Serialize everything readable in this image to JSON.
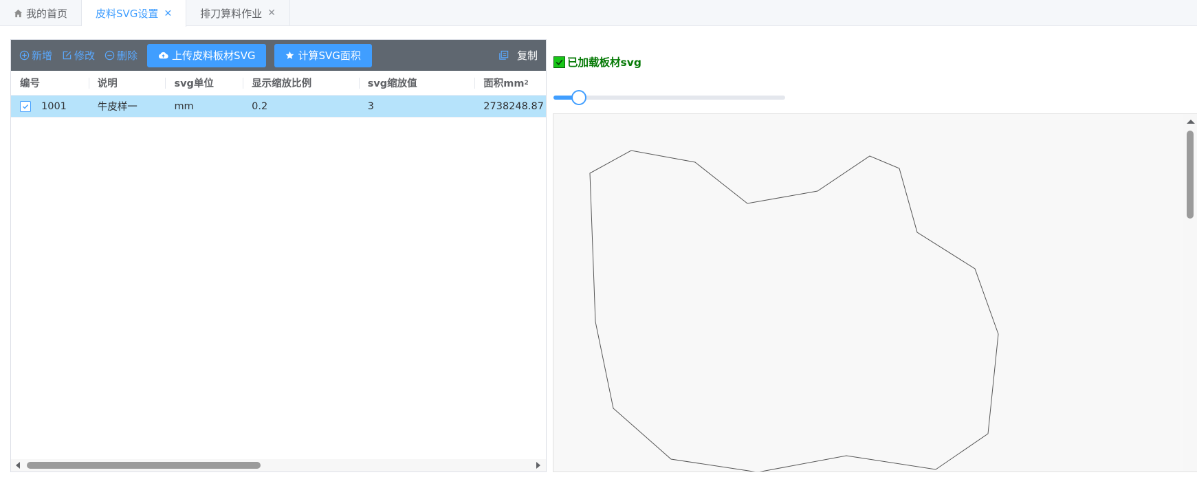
{
  "tabs": [
    {
      "label": "我的首页",
      "icon": "home-icon",
      "active": false,
      "closable": false
    },
    {
      "label": "皮料SVG设置",
      "active": true,
      "closable": true
    },
    {
      "label": "排刀算料作业",
      "active": false,
      "closable": true
    }
  ],
  "toolbar": {
    "add_label": "新增",
    "edit_label": "修改",
    "delete_label": "删除",
    "upload_label": "上传皮料板材SVG",
    "compute_label": "计算SVG面积",
    "copy_label": "复制"
  },
  "table": {
    "columns": [
      "编号",
      "说明",
      "svg单位",
      "显示缩放比例",
      "svg缩放值",
      "面积mm",
      "2"
    ],
    "rows": [
      {
        "checked": true,
        "id": "1001",
        "desc": "牛皮样一",
        "unit": "mm",
        "display_scale": "0.2",
        "svg_scale": "3",
        "area": "2738248.87"
      }
    ]
  },
  "preview": {
    "loaded_label": "已加载板材svg",
    "loaded_checked": true,
    "zoom_fraction": 0.11
  },
  "colors": {
    "accent": "#409eff",
    "toolbar_bg": "#5f6770",
    "selected_row": "#b6e3fb",
    "loaded_text": "#067a06"
  }
}
